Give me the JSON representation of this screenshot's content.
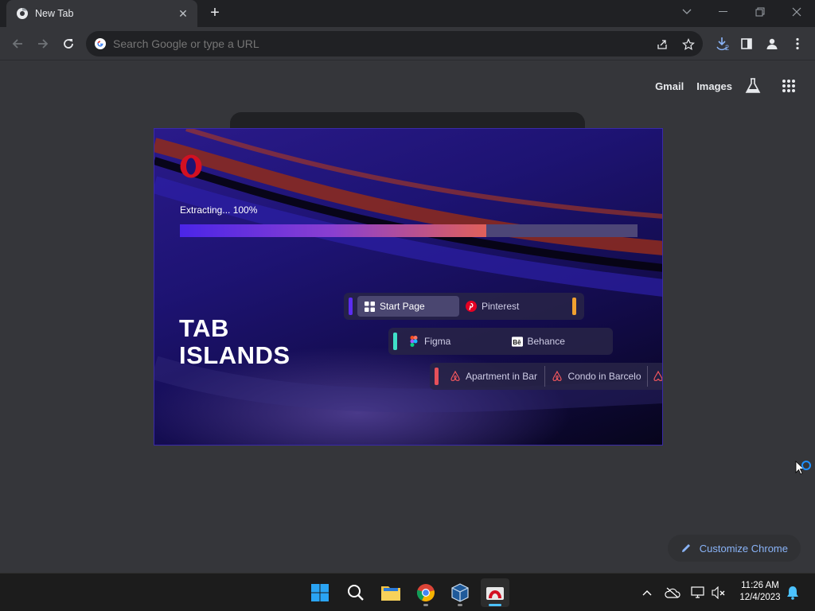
{
  "browser": {
    "tab": {
      "title": "New Tab",
      "close": "✕"
    },
    "new_tab": "+",
    "omnibox": {
      "placeholder": "Search Google or type a URL"
    },
    "download_count": "2"
  },
  "ntp": {
    "links": {
      "gmail": "Gmail",
      "images": "Images"
    },
    "customize_label": "Customize Chrome"
  },
  "ad": {
    "extract_label": "Extracting... 100%",
    "progress_fraction": 0.67,
    "headline_line1": "TAB",
    "headline_line2": "ISLANDS",
    "islands": [
      {
        "stripe": "#5b2cf0",
        "tabs": [
          {
            "label": "Start Page",
            "icon": "grid-icon",
            "active": true
          },
          {
            "label": "Pinterest",
            "icon": "pinterest-icon"
          }
        ],
        "end_stripe": "#f0a030"
      },
      {
        "stripe": "#3fe0c8",
        "tabs": [
          {
            "label": "Figma",
            "icon": "figma-icon"
          },
          {
            "label": "Behance",
            "icon": "behance-icon"
          }
        ]
      },
      {
        "stripe": "#e6505a",
        "tabs": [
          {
            "label": "Apartment in Bar",
            "icon": "airbnb-icon"
          },
          {
            "label": "Condo in Barcelo",
            "icon": "airbnb-icon"
          }
        ]
      }
    ],
    "brand_color": "#d31022"
  },
  "taskbar": {
    "time": "11:26 AM",
    "date": "12/4/2023"
  }
}
